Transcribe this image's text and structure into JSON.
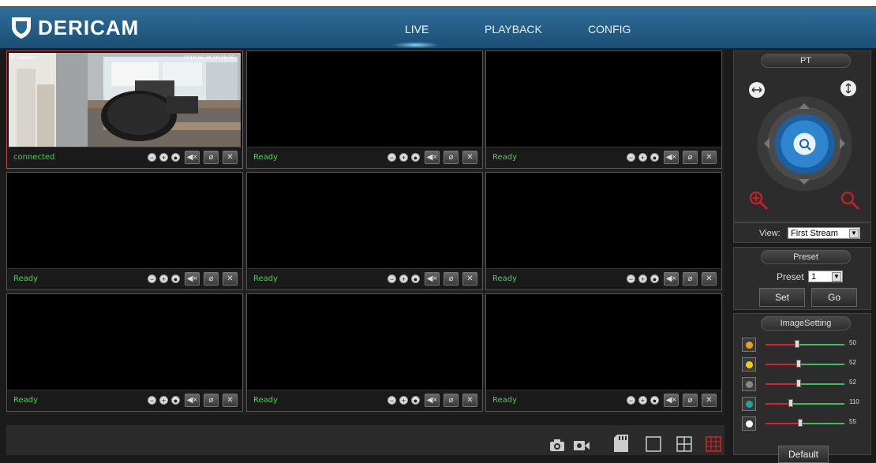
{
  "app": {
    "brand": "DERICAM"
  },
  "nav": {
    "live": "LIVE",
    "playback": "PLAYBACK",
    "config": "CONFIG"
  },
  "camera_view": {
    "status_connected": "connected",
    "status_ready": "Ready",
    "overlay_left": "IP Camera",
    "overlay_right": "2018-05-18 10:19:35"
  },
  "ptz": {
    "title": "PT"
  },
  "view": {
    "label": "View:",
    "value": "First Stream"
  },
  "preset": {
    "title": "Preset",
    "label": "Preset",
    "value": "1",
    "set": "Set",
    "go": "Go"
  },
  "image_setting": {
    "title": "ImageSetting",
    "sliders": [
      {
        "name": "brightness",
        "value": "50",
        "level": 0.4
      },
      {
        "name": "contrast",
        "value": "52",
        "level": 0.42
      },
      {
        "name": "saturation",
        "value": "52",
        "level": 0.42
      },
      {
        "name": "hue",
        "value": "110",
        "level": 0.32
      },
      {
        "name": "sharpness",
        "value": "55",
        "level": 0.44
      }
    ],
    "default": "Default"
  }
}
